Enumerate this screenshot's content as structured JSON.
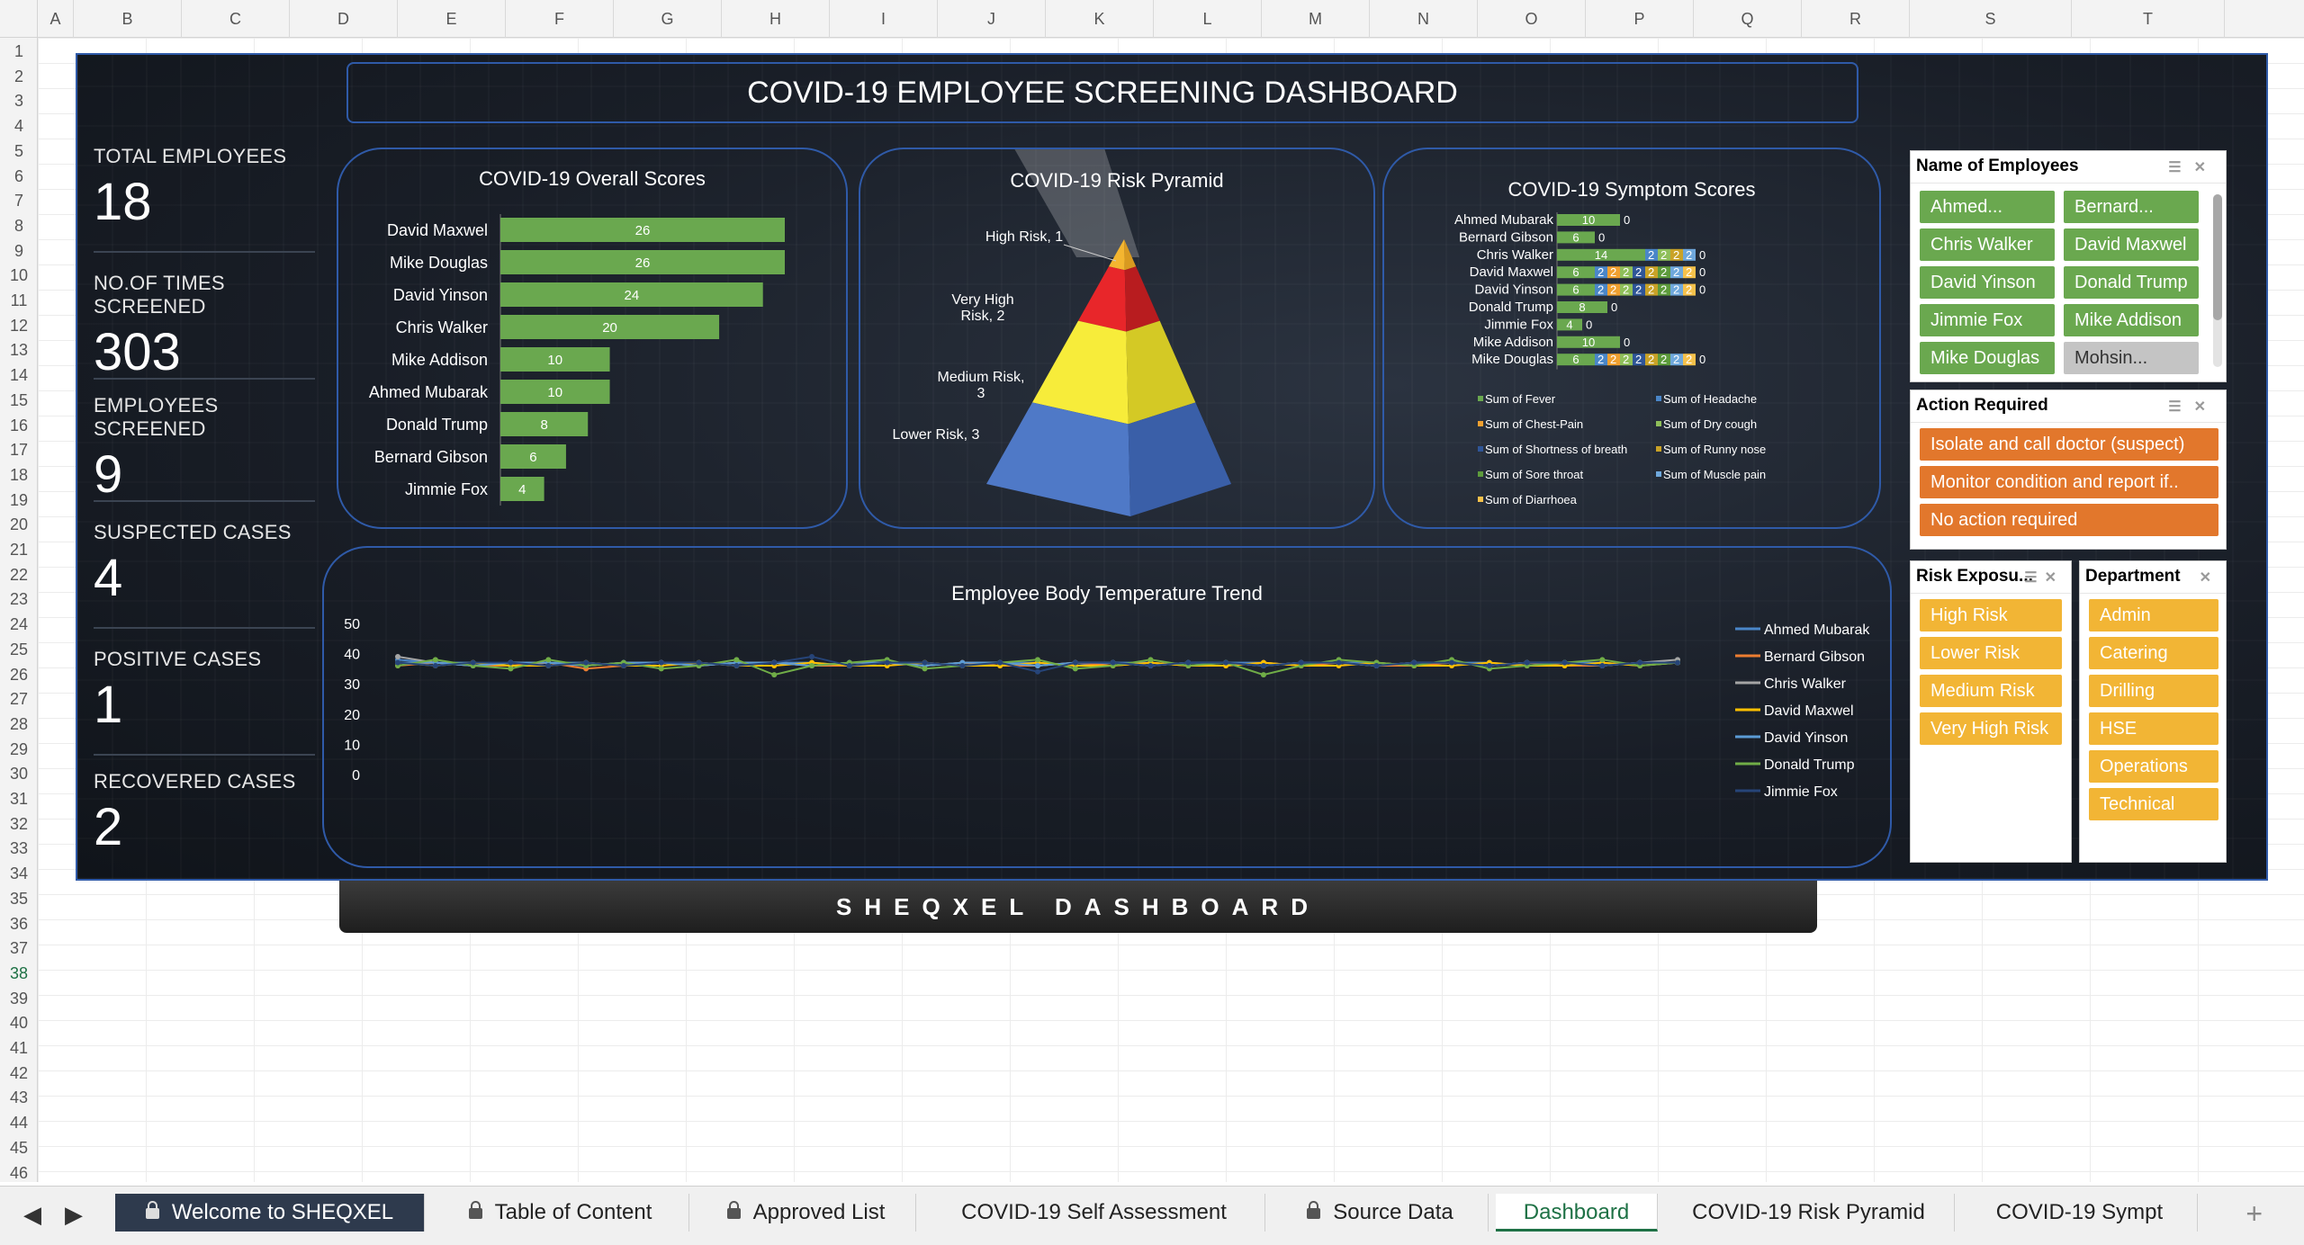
{
  "columns": [
    "A",
    "B",
    "C",
    "D",
    "E",
    "F",
    "G",
    "H",
    "I",
    "J",
    "K",
    "L",
    "M",
    "N",
    "O",
    "P",
    "Q",
    "R",
    "S",
    "T"
  ],
  "rows": [
    "1",
    "2",
    "3",
    "4",
    "5",
    "6",
    "7",
    "8",
    "9",
    "10",
    "11",
    "12",
    "13",
    "14",
    "15",
    "16",
    "17",
    "18",
    "19",
    "20",
    "21",
    "22",
    "23",
    "24",
    "25",
    "26",
    "27",
    "28",
    "29",
    "30",
    "31",
    "32",
    "33",
    "34",
    "35",
    "36",
    "37",
    "38",
    "39",
    "40",
    "41",
    "42",
    "43",
    "44",
    "45",
    "46"
  ],
  "dashboard": {
    "title": "COVID-19 EMPLOYEE SCREENING DASHBOARD",
    "footer": "SHEQXEL DASHBOARD",
    "stats": [
      {
        "label": "TOTAL EMPLOYEES",
        "value": "18"
      },
      {
        "label": "NO.OF TIMES SCREENED",
        "value": "303"
      },
      {
        "label": "EMPLOYEES SCREENED",
        "value": "9"
      },
      {
        "label": "SUSPECTED CASES",
        "value": "4"
      },
      {
        "label": "POSITIVE CASES",
        "value": "1"
      },
      {
        "label": "RECOVERED CASES",
        "value": "2"
      }
    ]
  },
  "chart_data": [
    {
      "type": "bar",
      "title": "COVID-19 Overall Scores",
      "categories": [
        "David Maxwel",
        "Mike Douglas",
        "David Yinson",
        "Chris Walker",
        "Mike Addison",
        "Ahmed Mubarak",
        "Donald Trump",
        "Bernard Gibson",
        "Jimmie Fox"
      ],
      "values": [
        26,
        26,
        24,
        20,
        10,
        10,
        8,
        6,
        4
      ],
      "color": "#6aa84f"
    },
    {
      "type": "pyramid",
      "title": "COVID-19 Risk Pyramid",
      "categories": [
        "High Risk",
        "Very High Risk",
        "Medium Risk",
        "Lower Risk"
      ],
      "values": [
        1,
        2,
        3,
        3
      ],
      "labels": [
        "High Risk, 1",
        "Very High Risk, 2",
        "Medium Risk, 3",
        "Lower Risk, 3"
      ],
      "colors": [
        "#f4b630",
        "#e8262a",
        "#f7ec3a",
        "#4f79c7"
      ]
    },
    {
      "type": "bar",
      "stacked": true,
      "title": "COVID-19 Symptom Scores",
      "categories": [
        "Ahmed Mubarak",
        "Bernard Gibson",
        "Chris Walker",
        "David Maxwel",
        "David Yinson",
        "Donald Trump",
        "Jimmie Fox",
        "Mike Addison",
        "Mike Douglas"
      ],
      "series": [
        {
          "name": "Sum of Fever",
          "color": "#6aa84f",
          "values": [
            10,
            6,
            14,
            6,
            6,
            8,
            4,
            10,
            6
          ]
        },
        {
          "name": "Sum of Headache",
          "color": "#4a86c8",
          "values": [
            0,
            0,
            2,
            2,
            2,
            0,
            0,
            0,
            2
          ]
        },
        {
          "name": "Sum of Chest-Pain",
          "color": "#f0a030",
          "values": [
            0,
            0,
            0,
            2,
            2,
            0,
            0,
            0,
            2
          ]
        },
        {
          "name": "Sum of Dry cough",
          "color": "#8fbf5a",
          "values": [
            0,
            0,
            2,
            2,
            2,
            0,
            0,
            0,
            2
          ]
        },
        {
          "name": "Sum of Shortness of breath",
          "color": "#2f5597",
          "values": [
            0,
            0,
            0,
            2,
            2,
            0,
            0,
            0,
            2
          ]
        },
        {
          "name": "Sum of Runny nose",
          "color": "#c9a227",
          "values": [
            0,
            0,
            2,
            2,
            2,
            0,
            0,
            0,
            2
          ]
        },
        {
          "name": "Sum of Sore throat",
          "color": "#5d9b3c",
          "values": [
            0,
            0,
            0,
            2,
            2,
            0,
            0,
            0,
            2
          ]
        },
        {
          "name": "Sum of Muscle pain",
          "color": "#6fa8dc",
          "values": [
            0,
            0,
            2,
            2,
            2,
            0,
            0,
            0,
            2
          ]
        },
        {
          "name": "Sum of Diarrhoea",
          "color": "#f6c14b",
          "values": [
            0,
            0,
            0,
            2,
            2,
            0,
            0,
            0,
            2
          ]
        }
      ],
      "legend": "bottom"
    },
    {
      "type": "line",
      "title": "Employee Body Temperature Trend",
      "ylim": [
        0,
        50
      ],
      "yticks": [
        "50",
        "40",
        "30",
        "20",
        "10",
        "0"
      ],
      "legend": "right",
      "series": [
        {
          "name": "Ahmed Mubarak",
          "color": "#4a86c8",
          "values": [
            38,
            37,
            37,
            36,
            37,
            37,
            36,
            37,
            37,
            36,
            37,
            37,
            36,
            37,
            37,
            36,
            37,
            37,
            36,
            37,
            37,
            36,
            37,
            37,
            36,
            37,
            37,
            36,
            37,
            37,
            36,
            37,
            37,
            36,
            37
          ]
        },
        {
          "name": "Bernard Gibson",
          "color": "#ed7d31",
          "values": [
            36,
            37,
            36,
            36,
            37,
            35,
            36,
            37,
            36,
            37,
            37,
            36,
            36,
            37,
            36,
            37,
            36,
            36,
            37,
            36,
            37,
            36,
            36,
            37,
            36,
            37,
            36,
            36,
            37,
            36,
            37,
            36,
            36,
            37,
            37
          ]
        },
        {
          "name": "Chris Walker",
          "color": "#a5a5a5",
          "values": [
            39,
            37,
            36,
            37,
            37,
            36,
            37,
            37,
            36,
            37,
            37,
            36,
            37,
            37,
            36,
            37,
            37,
            36,
            37,
            37,
            36,
            37,
            37,
            36,
            37,
            37,
            36,
            37,
            37,
            36,
            37,
            37,
            36,
            37,
            38
          ]
        },
        {
          "name": "David Maxwel",
          "color": "#ffc000",
          "values": [
            37,
            36,
            37,
            36,
            36,
            37,
            36,
            36,
            37,
            36,
            36,
            37,
            36,
            36,
            37,
            36,
            36,
            37,
            36,
            36,
            37,
            36,
            36,
            37,
            36,
            36,
            37,
            36,
            36,
            37,
            36,
            36,
            37,
            36,
            37
          ]
        },
        {
          "name": "David Yinson",
          "color": "#5b9bd5",
          "values": [
            37,
            37,
            36,
            37,
            37,
            36,
            37,
            37,
            36,
            37,
            37,
            36,
            37,
            37,
            36,
            37,
            37,
            36,
            37,
            37,
            36,
            37,
            37,
            36,
            37,
            37,
            36,
            37,
            37,
            36,
            37,
            37,
            36,
            37,
            37
          ]
        },
        {
          "name": "Donald Trump",
          "color": "#70ad47",
          "values": [
            36,
            38,
            36,
            35,
            38,
            36,
            37,
            35,
            36,
            38,
            33,
            36,
            37,
            38,
            35,
            36,
            37,
            38,
            35,
            36,
            38,
            36,
            37,
            33,
            36,
            38,
            37,
            36,
            38,
            35,
            36,
            37,
            38,
            36,
            37
          ]
        },
        {
          "name": "Jimmie Fox",
          "color": "#264478",
          "values": [
            37,
            36,
            37,
            37,
            36,
            37,
            36,
            37,
            37,
            36,
            37,
            39,
            36,
            37,
            37,
            36,
            37,
            34,
            37,
            37,
            36,
            37,
            37,
            36,
            37,
            37,
            36,
            37,
            37,
            36,
            37,
            37,
            36,
            37,
            37
          ]
        }
      ]
    }
  ],
  "slicers": {
    "employees": {
      "title": "Name of Employees",
      "items": [
        "Ahmed...",
        "Bernard...",
        "Chris Walker",
        "David Maxwel",
        "David Yinson",
        "Donald Trump",
        "Jimmie Fox",
        "Mike Addison",
        "Mike Douglas",
        "Mohsin..."
      ]
    },
    "action": {
      "title": "Action Required",
      "items": [
        "Isolate and call doctor (suspect)",
        "Monitor condition and report if..",
        "No action required"
      ]
    },
    "risk": {
      "title": "Risk Exposu...",
      "items": [
        "High Risk",
        "Lower Risk",
        "Medium Risk",
        "Very High Risk"
      ]
    },
    "department": {
      "title": "Department",
      "items": [
        "Admin",
        "Catering",
        "Drilling",
        "HSE",
        "Operations",
        "Technical"
      ]
    }
  },
  "tabs": [
    "Welcome to SHEQXEL",
    "Table of Content",
    "Approved List",
    "COVID-19 Self Assessment",
    "Source Data",
    "Dashboard",
    "COVID-19 Risk Pyramid",
    "COVID-19 Sympt"
  ],
  "active_tab": "Dashboard",
  "active_row": "38"
}
